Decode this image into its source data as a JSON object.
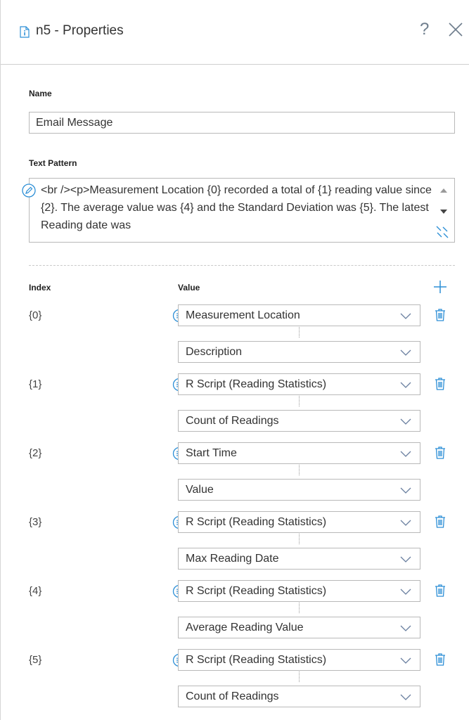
{
  "header": {
    "title": "n5 - Properties",
    "help_label": "?"
  },
  "form": {
    "name_label": "Name",
    "name_value": "Email Message",
    "text_pattern_label": "Text Pattern",
    "text_pattern_value": "<br /><p>Measurement Location {0} recorded a total of {1} reading value since {2}. The average value was {4} and the Standard Deviation was {5}. The latest Reading date was"
  },
  "table": {
    "index_header": "Index",
    "value_header": "Value",
    "rows": [
      {
        "index": "{0}",
        "source": "Measurement Location",
        "field": "Description"
      },
      {
        "index": "{1}",
        "source": "R Script (Reading Statistics)",
        "field": "Count of Readings"
      },
      {
        "index": "{2}",
        "source": "Start Time",
        "field": "Value"
      },
      {
        "index": "{3}",
        "source": "R Script (Reading Statistics)",
        "field": "Max Reading Date"
      },
      {
        "index": "{4}",
        "source": "R Script (Reading Statistics)",
        "field": "Average Reading Value"
      },
      {
        "index": "{5}",
        "source": "R Script (Reading Statistics)",
        "field": "Count of Readings"
      }
    ]
  },
  "colors": {
    "accent": "#2d8fd6",
    "muted_icon": "#6f7e8d",
    "border": "#b9b9b9"
  }
}
